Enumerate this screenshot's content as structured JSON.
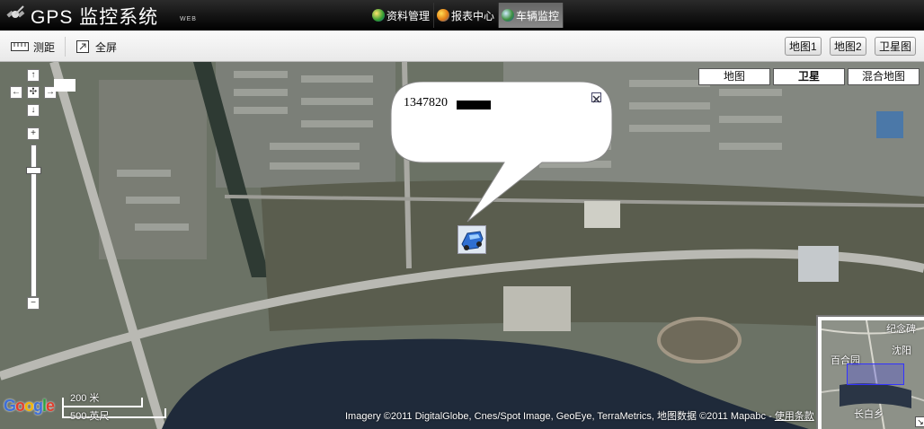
{
  "app": {
    "title": "GPS 监控系统",
    "subtitle": "WEB"
  },
  "nav": {
    "tabs": [
      {
        "label": "资料管理",
        "icon": "globe-icon"
      },
      {
        "label": "报表中心",
        "icon": "chart-icon"
      },
      {
        "label": "车辆监控",
        "icon": "monitor-icon",
        "active": true
      }
    ]
  },
  "toolbar": {
    "measure_label": "测距",
    "fullscreen_label": "全屏",
    "map1_label": "地图1",
    "map2_label": "地图2",
    "satellite_label": "卫星图"
  },
  "map": {
    "map_types": [
      {
        "label": "地图"
      },
      {
        "label": "卫星",
        "selected": true
      },
      {
        "label": "混合地图"
      }
    ],
    "popup_text": "1347820",
    "attribution": "Imagery ©2011 DigitalGlobe, Cnes/Spot Image, GeoEye, TerraMetrics, 地图数据 ©2011 Mapabc - ",
    "terms_link": "使用条款",
    "scale_metric": "200 米",
    "scale_imperial": "500 英尺",
    "logo": "Google",
    "overview_labels": {
      "top": "纪念碑",
      "right": "沈阳",
      "left": "百合园",
      "bottom": "长白乡"
    },
    "colors": {
      "water": "#1f2a3a",
      "road": "#b9b9b3",
      "overview_box": "#3333ff"
    }
  }
}
